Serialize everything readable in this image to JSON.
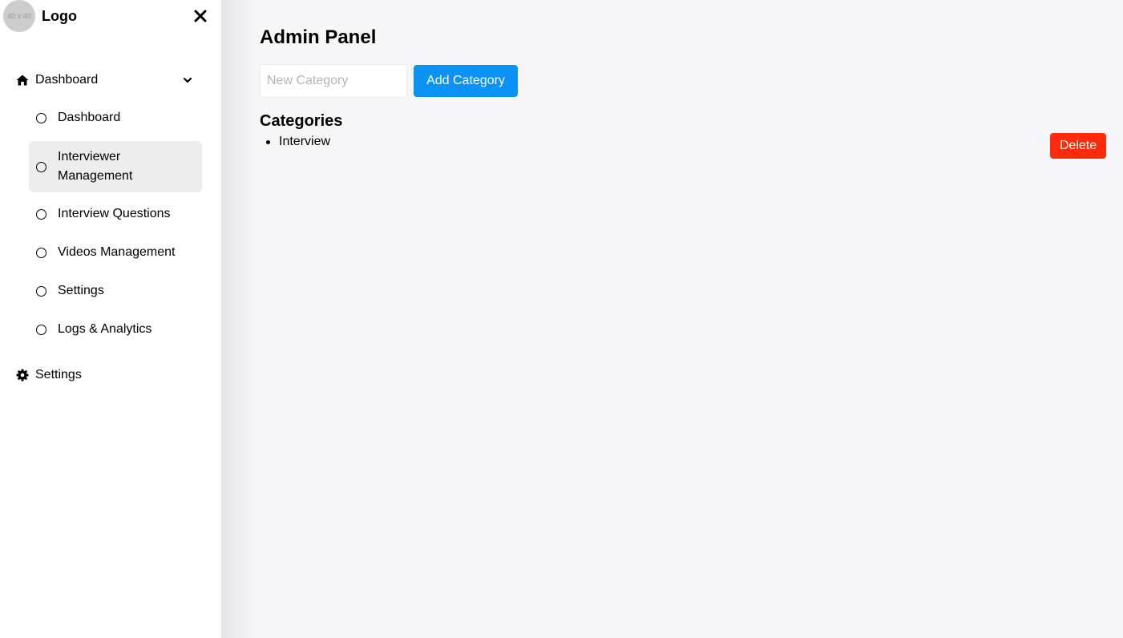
{
  "brand": {
    "logo_text": "40 x 40",
    "title": "Logo"
  },
  "sidebar": {
    "group": {
      "label": "Dashboard",
      "icon": "home-icon",
      "expanded": true
    },
    "items": [
      {
        "label": "Dashboard",
        "active": false
      },
      {
        "label": "Interviewer Management",
        "active": true
      },
      {
        "label": "Interview Questions",
        "active": false
      },
      {
        "label": "Videos Management",
        "active": false
      },
      {
        "label": "Settings",
        "active": false
      },
      {
        "label": "Logs & Analytics",
        "active": false
      }
    ],
    "settings": {
      "label": "Settings",
      "icon": "gear-icon"
    }
  },
  "main": {
    "title": "Admin Panel",
    "input": {
      "placeholder": "New Category",
      "value": ""
    },
    "add_button": "Add Category",
    "section_title": "Categories",
    "categories": [
      {
        "name": "Interview",
        "delete_label": "Delete"
      }
    ]
  },
  "colors": {
    "primary": "#0a93f5",
    "danger": "#ff2a0a",
    "active_bg": "#ededed",
    "page_bg": "#f7f6f9"
  }
}
